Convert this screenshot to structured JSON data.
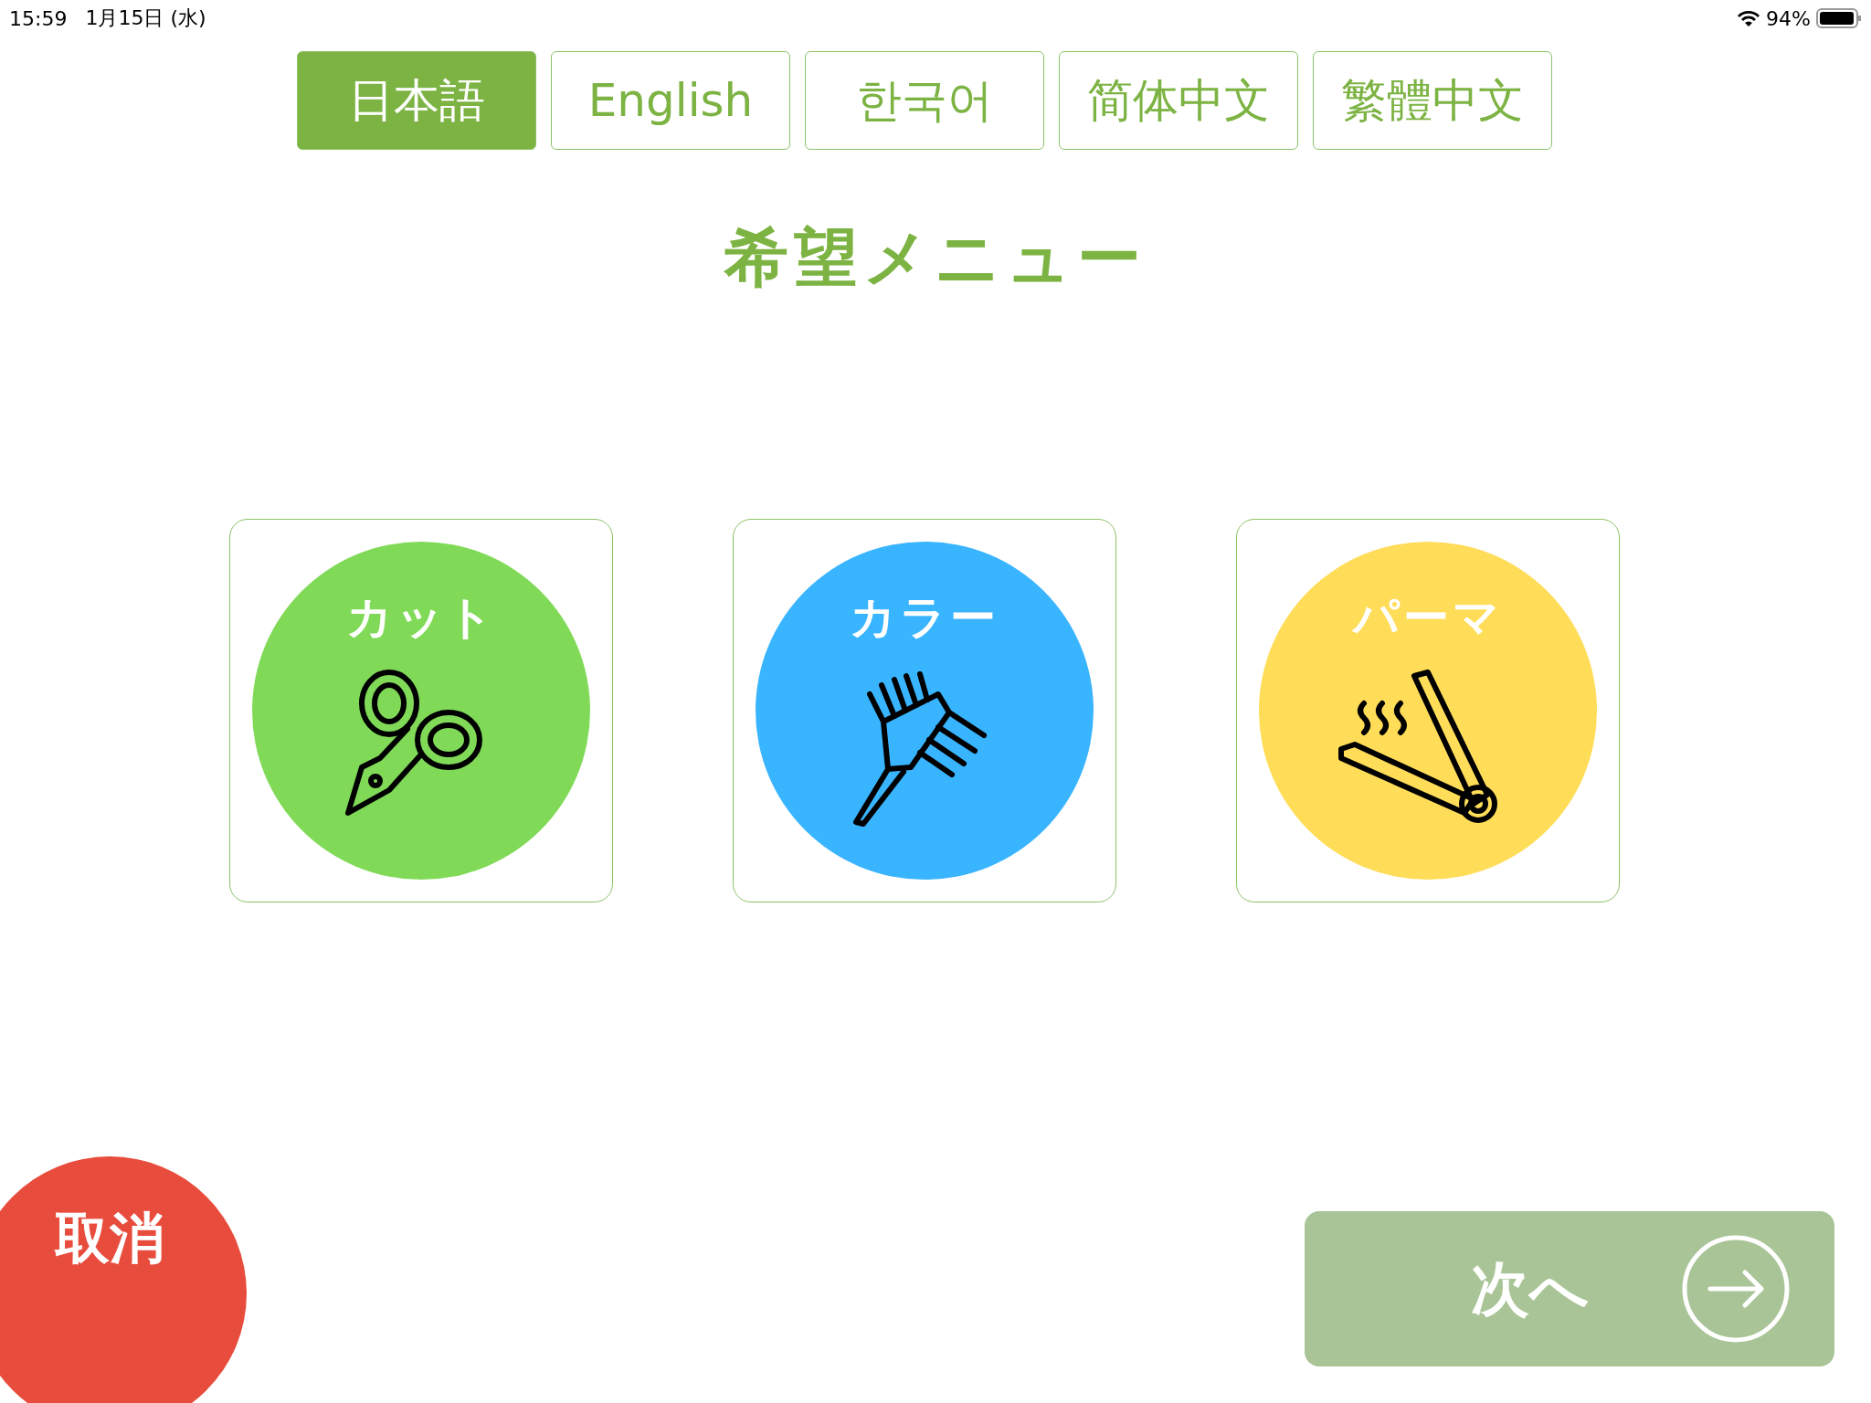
{
  "status_bar": {
    "time": "15:59",
    "date": "1月15日 (水)",
    "battery": "94%"
  },
  "languages": [
    {
      "label": "日本語",
      "selected": true
    },
    {
      "label": "English",
      "selected": false
    },
    {
      "label": "한국어",
      "selected": false
    },
    {
      "label": "简体中文",
      "selected": false
    },
    {
      "label": "繁體中文",
      "selected": false
    }
  ],
  "title": "希望メニュー",
  "menu": [
    {
      "label": "カット",
      "kind": "scissors",
      "color": "#80da58"
    },
    {
      "label": "カラー",
      "kind": "brush",
      "color": "#39b4ff"
    },
    {
      "label": "パーマ",
      "kind": "iron",
      "color": "#ffdd59"
    }
  ],
  "cancel_button": {
    "label": "取消"
  },
  "next_button": {
    "label": "次へ",
    "disabled": true
  }
}
